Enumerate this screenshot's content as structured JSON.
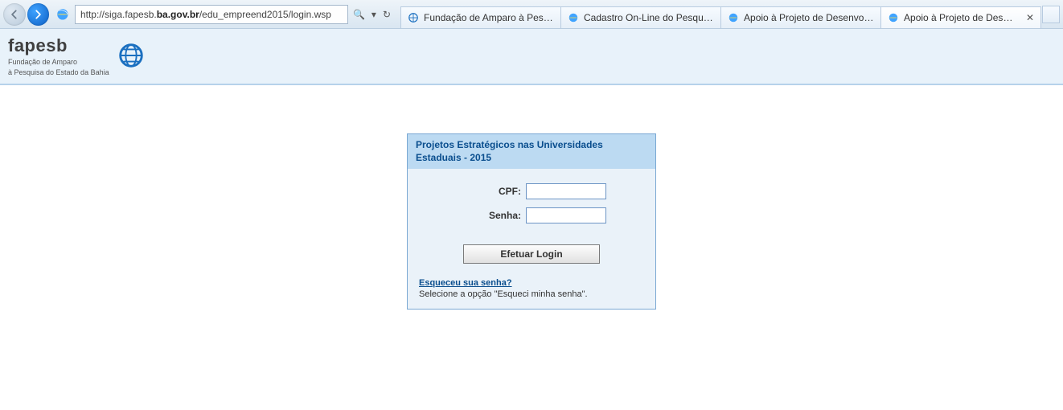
{
  "browser": {
    "url_prefix": "http://siga.fapesb.",
    "url_bold": "ba.gov.br",
    "url_suffix": "/edu_empreend2015/login.wsp",
    "search_glyph": "🔍",
    "dropdown_glyph": "▾",
    "refresh_glyph": "↻",
    "tabs": [
      {
        "label": "Fundação de Amparo à Pesqui...",
        "icon": "fapesb"
      },
      {
        "label": "Cadastro On-Line do Pesquisa...",
        "icon": "ie"
      },
      {
        "label": "Apoio à Projeto de Desenvolvi...",
        "icon": "ie"
      },
      {
        "label": "Apoio à Projeto de Desenvo...",
        "icon": "ie",
        "active": true,
        "closeable": true
      }
    ]
  },
  "header": {
    "brand": "fapesb",
    "sub1": "Fundação de Amparo",
    "sub2": "à Pesquisa do Estado da Bahia"
  },
  "login": {
    "title": "Projetos Estratégicos nas Universidades Estaduais - 2015",
    "cpf_label": "CPF:",
    "cpf_value": "",
    "senha_label": "Senha:",
    "senha_value": "",
    "button_label": "Efetuar Login",
    "forgot_link": "Esqueceu sua senha?",
    "forgot_text": "Selecione a opção \"Esqueci minha senha\"."
  }
}
